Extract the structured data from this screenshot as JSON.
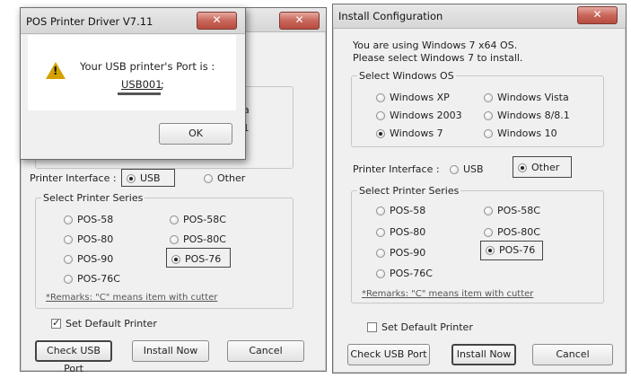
{
  "left_window": {
    "title": "POS Printer Driver V7.11",
    "obscured_text_1": "a",
    "obscured_text_2": ".1",
    "printer_interface_label": "Printer Interface :",
    "interface_usb": "USB",
    "interface_other": "Other",
    "series_group_label": "Select Printer Series",
    "series": [
      "POS-58",
      "POS-58C",
      "POS-80",
      "POS-80C",
      "POS-90",
      "POS-76",
      "POS-76C"
    ],
    "selected_series": "POS-76",
    "remarks": "*Remarks: \"C\" means item with cutter",
    "set_default_label": "Set Default Printer",
    "set_default_checked": true,
    "check_usb_button": "Check USB Port",
    "install_button": "Install Now",
    "cancel_button": "Cancel"
  },
  "popup": {
    "title": "POS Printer Driver V7.11",
    "message": "Your USB printer's Port is :",
    "port": "USB001",
    "port_suffix": ";",
    "ok_button": "OK",
    "icon": "warning-icon"
  },
  "right_window": {
    "title": "Install Configuration",
    "info_line_1": "You are using Windows 7 x64 OS.",
    "info_line_2": "Please select Windows 7 to install.",
    "os_group_label": "Select Windows OS",
    "os_options": [
      "Windows XP",
      "Windows Vista",
      "Windows 2003",
      "Windows 8/8.1",
      "Windows 7",
      "Windows 10"
    ],
    "selected_os": "Windows 7",
    "printer_interface_label": "Printer Interface :",
    "interface_usb": "USB",
    "interface_other": "Other",
    "series_group_label": "Select Printer Series",
    "series": [
      "POS-58",
      "POS-58C",
      "POS-80",
      "POS-80C",
      "POS-90",
      "POS-76",
      "POS-76C"
    ],
    "selected_series": "POS-76",
    "remarks": "*Remarks: \"C\" means item with cutter",
    "set_default_label": "Set Default Printer",
    "set_default_checked": false,
    "check_usb_button": "Check USB Port",
    "install_button": "Install Now",
    "cancel_button": "Cancel"
  },
  "colors": {
    "dialog_bg": "#f0f0f0",
    "close_red": "#c9665a"
  }
}
